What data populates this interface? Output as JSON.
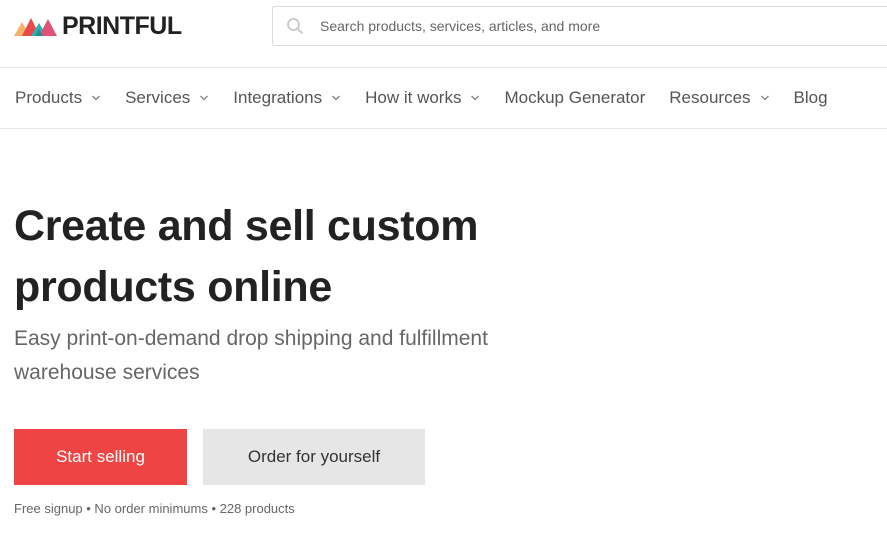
{
  "brand": {
    "name": "PRINTFUL",
    "logo_colors": [
      "#f4b26a",
      "#e84a4a",
      "#2ab3b3",
      "#e0527a"
    ]
  },
  "search": {
    "placeholder": "Search products, services, articles, and more",
    "icon": "search-icon"
  },
  "nav": {
    "items": [
      {
        "label": "Products",
        "has_dropdown": true
      },
      {
        "label": "Services",
        "has_dropdown": true
      },
      {
        "label": "Integrations",
        "has_dropdown": true
      },
      {
        "label": "How it works",
        "has_dropdown": true
      },
      {
        "label": "Mockup Generator",
        "has_dropdown": false
      },
      {
        "label": "Resources",
        "has_dropdown": true
      },
      {
        "label": "Blog",
        "has_dropdown": false
      }
    ]
  },
  "hero": {
    "title": "Create and sell custom products online",
    "subtitle": "Easy print-on-demand drop shipping and fulfillment warehouse services",
    "primary_cta": "Start selling",
    "secondary_cta": "Order for yourself",
    "footnote": "Free signup • No order minimums • 228 products"
  },
  "colors": {
    "primary": "#ef4444",
    "secondary_bg": "#e6e6e6",
    "text_dark": "#222222",
    "text_muted": "#666666"
  }
}
